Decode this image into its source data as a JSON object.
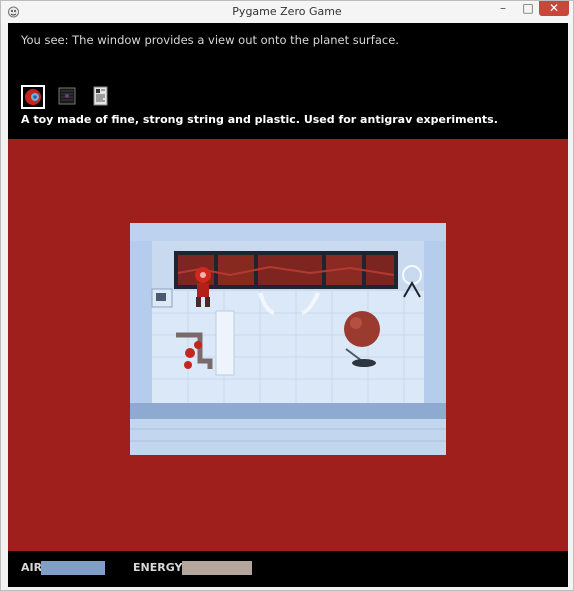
{
  "window": {
    "title": "Pygame Zero Game",
    "min_glyph": "–",
    "max_glyph": "□",
    "close_glyph": "✕"
  },
  "hud": {
    "you_see_text": "You see: The window provides a view out onto the planet surface.",
    "inventory": [
      {
        "item": "yoyo",
        "icon": "red-yoyo-icon",
        "selected": true
      },
      {
        "item": "item-2",
        "icon": "dark-panel-icon",
        "selected": false
      },
      {
        "item": "item-3",
        "icon": "document-icon",
        "selected": false
      }
    ],
    "selected_item_description": "A toy made of fine, strong string and plastic. Used for antigrav experiments.",
    "air_label": "AIR",
    "energy_label": "ENERGY"
  },
  "colors": {
    "play_background": "#9e1f1c",
    "air_bar": "#7f9fc6",
    "energy_bar": "#b5a69d"
  },
  "meters": {
    "air_level": 1.0,
    "energy_level": 1.0
  }
}
